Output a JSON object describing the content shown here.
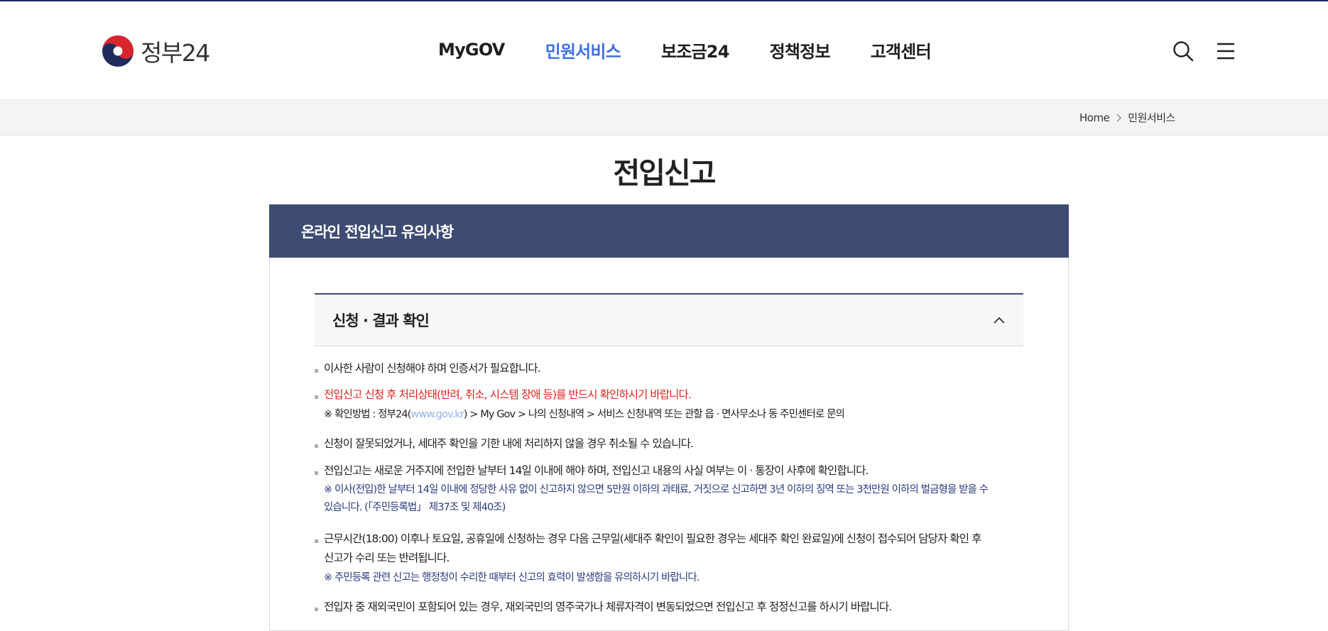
{
  "header": {
    "logo_text": "정부24",
    "nav": [
      {
        "label": "MyGOV"
      },
      {
        "label": "민원서비스"
      },
      {
        "label": "보조금24"
      },
      {
        "label": "정책정보"
      },
      {
        "label": "고객센터"
      }
    ],
    "active_nav": "민원서비스",
    "colors": {
      "accent": "#3e6fe0",
      "top_line": "#1f2c5c"
    },
    "icons": [
      "search-icon",
      "hamburger-menu-icon"
    ]
  },
  "breadcrumb": {
    "home": "Home",
    "current": "민원서비스"
  },
  "page_title": "전입신고",
  "notice": {
    "title": "온라인 전입신고 유의사항",
    "colors": {
      "header_bg": "#3e4c73"
    },
    "accordion": {
      "title": "신청 · 결과 확인",
      "expanded": true
    },
    "items": [
      {
        "text": "이사한 사람이 신청해야 하며 인증서가 필요합니다."
      },
      {
        "text": "전입신고 신청 후 처리상태(반려, 취소, 시스템 장애 등)를 반드시 확인하시기 바랍니다.",
        "note_prefix": "※ 확인방법 : 정부24(",
        "note_link": "www.gov.kr",
        "note_suffix": ") > My Gov > 나의 신청내역 > 서비스 신청내역 또는 관할 읍 · 면사무소나 동 주민센터로 문의"
      },
      {
        "text": "신청이 잘못되었거나, 세대주 확인을 기한 내에 처리하지 않을 경우 취소될 수 있습니다."
      },
      {
        "text": "전입신고는 새로운 거주지에 전입한 날부터 14일 이내에 해야 하며, 전입신고 내용의 사실 여부는 이 · 통장이 사후에 확인합니다.",
        "note_line1": "※ 이사(전입)한 날부터 14일 이내에 정당한 사유 없이 신고하지 않으면 5만원 이하의 과태료, 거짓으로 신고하면 3년 이하의 징역 또는 3천만원 이하의 벌금형을 받을 수",
        "note_line2": "있습니다. (「주민등록법」 제37조 및 제40조)"
      },
      {
        "text_line1": "근무시간(18:00) 이후나 토요일, 공휴일에 신청하는 경우 다음 근무일(세대주 확인이 필요한 경우는 세대주 확인 완료일)에 신청이 접수되어 담당자 확인 후",
        "text_line2": "신고가 수리 또는 반려됩니다.",
        "note": "※ 주민등록 관련 신고는 행정청이 수리한 때부터 신고의 효력이 발생함을 유의하시기 바랍니다."
      },
      {
        "text": "전입자 중 재외국민이 포함되어 있는 경우, 재외국민의 영주국가나 체류자격이 변동되었으면 전입신고 후 정정신고를 하시기 바랍니다."
      }
    ]
  }
}
